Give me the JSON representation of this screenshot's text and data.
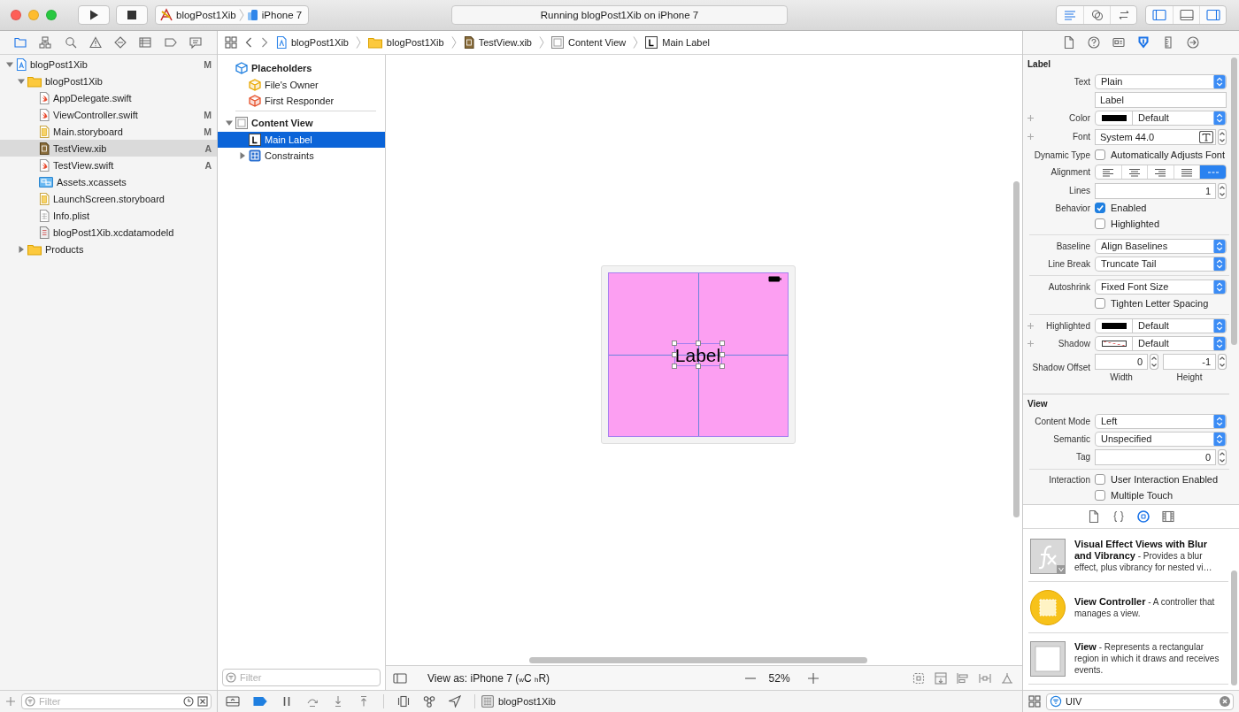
{
  "toolbar": {
    "scheme": "blogPost1Xib",
    "device": "iPhone 7",
    "activity": "Running blogPost1Xib on iPhone 7",
    "editor_modes": [
      {
        "kind": "standard",
        "selected": true
      },
      {
        "kind": "assistant",
        "selected": false
      },
      {
        "kind": "version",
        "selected": false
      }
    ],
    "panels": [
      {
        "kind": "navigator",
        "on": true
      },
      {
        "kind": "debug",
        "on": false
      },
      {
        "kind": "inspector",
        "on": true
      }
    ]
  },
  "navigator": {
    "tabs": [
      {
        "kind": "project",
        "selected": true
      },
      {
        "kind": "symbols",
        "selected": false
      },
      {
        "kind": "find",
        "selected": false
      },
      {
        "kind": "issues",
        "selected": false
      },
      {
        "kind": "tests",
        "selected": false
      },
      {
        "kind": "debug",
        "selected": false
      },
      {
        "kind": "breakpoints",
        "selected": false
      },
      {
        "kind": "reports",
        "selected": false
      }
    ],
    "tree": [
      {
        "name": "blogPost1Xib",
        "kind": "project",
        "badge": "M",
        "expanded": true,
        "selected": false,
        "children": [
          {
            "name": "blogPost1Xib",
            "kind": "folder",
            "expanded": true,
            "selected": false,
            "children": [
              {
                "name": "AppDelegate.swift",
                "kind": "swift",
                "selected": false
              },
              {
                "name": "ViewController.swift",
                "kind": "swift",
                "badge": "M",
                "selected": false
              },
              {
                "name": "Main.storyboard",
                "kind": "storyboard",
                "badge": "M",
                "selected": false
              },
              {
                "name": "TestView.xib",
                "kind": "xib",
                "badge": "A",
                "selected": true
              },
              {
                "name": "TestView.swift",
                "kind": "swift",
                "badge": "A",
                "selected": false
              },
              {
                "name": "Assets.xcassets",
                "kind": "assets",
                "selected": false
              },
              {
                "name": "LaunchScreen.storyboard",
                "kind": "storyboard",
                "selected": false
              },
              {
                "name": "Info.plist",
                "kind": "plist",
                "selected": false
              },
              {
                "name": "blogPost1Xib.xcdatamodeld",
                "kind": "datamodel",
                "selected": false
              }
            ]
          },
          {
            "name": "Products",
            "kind": "folder",
            "expanded": false,
            "selected": false
          }
        ]
      }
    ],
    "filter": {
      "placeholder": "Filter"
    }
  },
  "jump_bar": {
    "items": [
      {
        "kind": "project",
        "label": "blogPost1Xib"
      },
      {
        "kind": "folder",
        "label": "blogPost1Xib"
      },
      {
        "kind": "xib",
        "label": "TestView.xib"
      },
      {
        "kind": "view",
        "label": "Content View"
      },
      {
        "kind": "label",
        "label": "Main Label"
      }
    ]
  },
  "outline": {
    "tree": [
      {
        "name": "Placeholders",
        "kind": "placeholder",
        "selected": false,
        "children": [
          {
            "name": "File's Owner",
            "kind": "owner",
            "selected": false
          },
          {
            "name": "First Responder",
            "kind": "responder",
            "selected": false
          }
        ]
      },
      {
        "name": "Content View",
        "kind": "view",
        "expanded": true,
        "selected": false,
        "children": [
          {
            "name": "Main Label",
            "kind": "label",
            "selected": true
          },
          {
            "name": "Constraints",
            "kind": "constraints",
            "expanded": false,
            "selected": false
          }
        ]
      }
    ],
    "filter": {
      "placeholder": "Filter"
    }
  },
  "canvas": {
    "label_text": "Label",
    "view_as": "View as: iPhone 7 ($_{w}$C $_{h}$R)",
    "zoom": "52%"
  },
  "inspector": {
    "tabs": [
      {
        "kind": "file",
        "selected": false
      },
      {
        "kind": "help",
        "selected": false
      },
      {
        "kind": "identity",
        "selected": false
      },
      {
        "kind": "attributes",
        "selected": true
      },
      {
        "kind": "size",
        "selected": false
      },
      {
        "kind": "connections",
        "selected": false
      }
    ],
    "sections": [
      {
        "title": "Label",
        "rows": [
          {
            "kind": "popup",
            "label": "Text",
            "value": "Plain"
          },
          {
            "kind": "field",
            "value": "Label"
          },
          {
            "kind": "color",
            "label": "Color",
            "value": "Default",
            "color": "#000000",
            "addable": true
          },
          {
            "kind": "font",
            "label": "Font",
            "value": "System 44.0",
            "addable": true
          },
          {
            "kind": "check",
            "label": "Dynamic Type",
            "text": "Automatically Adjusts Font",
            "checked": false
          },
          {
            "kind": "segments",
            "label": "Alignment",
            "segments": [
              {
                "kind": "left",
                "selected": false
              },
              {
                "kind": "center",
                "selected": false
              },
              {
                "kind": "right",
                "selected": false
              },
              {
                "kind": "justify",
                "selected": false
              },
              {
                "kind": "natural",
                "selected": true
              }
            ]
          },
          {
            "kind": "stepper",
            "label": "Lines",
            "value": "1"
          },
          {
            "kind": "check",
            "label": "Behavior",
            "text": "Enabled",
            "checked": true
          },
          {
            "kind": "check",
            "text": "Highlighted",
            "checked": false
          },
          {
            "kind": "popup",
            "label": "Baseline",
            "value": "Align Baselines",
            "separated": true
          },
          {
            "kind": "popup",
            "label": "Line Break",
            "value": "Truncate Tail"
          },
          {
            "kind": "popup",
            "label": "Autoshrink",
            "value": "Fixed Font Size",
            "separated": true
          },
          {
            "kind": "check",
            "text": "Tighten Letter Spacing",
            "checked": false
          },
          {
            "kind": "color",
            "label": "Highlighted",
            "value": "Default",
            "color": "#000000",
            "addable": true,
            "separated": true
          },
          {
            "kind": "color",
            "label": "Shadow",
            "value": "Default",
            "addable": true
          },
          {
            "kind": "pair",
            "label": "Shadow Offset",
            "fields": [
              {
                "value": "0",
                "caption": "Width"
              },
              {
                "value": "-1",
                "caption": "Height"
              }
            ]
          }
        ]
      },
      {
        "title": "View",
        "rows": [
          {
            "kind": "popup",
            "label": "Content Mode",
            "value": "Left"
          },
          {
            "kind": "popup",
            "label": "Semantic",
            "value": "Unspecified"
          },
          {
            "kind": "stepper",
            "label": "Tag",
            "value": "0"
          },
          {
            "kind": "check",
            "label": "Interaction",
            "text": "User Interaction Enabled",
            "checked": false,
            "separated": true
          },
          {
            "kind": "check",
            "text": "Multiple Touch",
            "checked": false
          }
        ]
      }
    ]
  },
  "library": {
    "tabs": [
      {
        "kind": "file",
        "selected": false
      },
      {
        "kind": "snippets",
        "selected": false
      },
      {
        "kind": "objects",
        "selected": true
      },
      {
        "kind": "media",
        "selected": false
      }
    ],
    "items": [
      {
        "kind": "effect",
        "text": "**Visual Effect Views with Blur and Vibrancy** - Provides a blur effect, plus vibrancy for nested vi…"
      },
      {
        "kind": "controller",
        "text": "**View Controller** - A controller that manages a view."
      },
      {
        "kind": "view",
        "text": "**View** - Represents a rectangular region in which it draws and receives events."
      }
    ],
    "search": {
      "value": "UIV"
    }
  },
  "debug_bar": {
    "breakpoints_active": true,
    "target": "blogPost1Xib"
  }
}
